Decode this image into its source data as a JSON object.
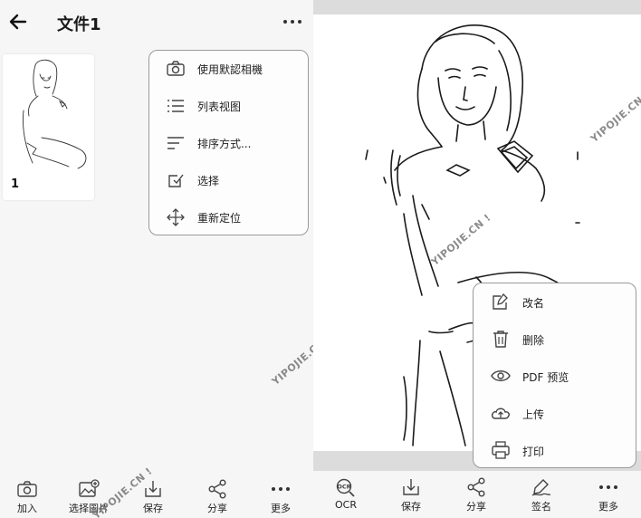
{
  "left_screen": {
    "title": "文件1",
    "page_number": "1",
    "menu": [
      {
        "label": "使用默認相機",
        "icon": "camera-icon"
      },
      {
        "label": "列表视图",
        "icon": "list-icon"
      },
      {
        "label": "排序方式...",
        "icon": "sort-icon"
      },
      {
        "label": "选择",
        "icon": "select-checkbox-icon"
      },
      {
        "label": "重新定位",
        "icon": "move-arrows-icon"
      }
    ],
    "bottom_bar": [
      {
        "label": "加入",
        "icon": "camera-icon"
      },
      {
        "label": "选择圖片",
        "icon": "add-image-icon"
      },
      {
        "label": "保存",
        "icon": "download-icon"
      },
      {
        "label": "分享",
        "icon": "share-icon"
      },
      {
        "label": "更多",
        "icon": "more-dots-icon"
      }
    ]
  },
  "right_screen": {
    "menu": [
      {
        "label": "改名",
        "icon": "rename-icon"
      },
      {
        "label": "删除",
        "icon": "trash-icon"
      },
      {
        "label": "PDF 预览",
        "icon": "eye-icon"
      },
      {
        "label": "上传",
        "icon": "cloud-upload-icon"
      },
      {
        "label": "打印",
        "icon": "printer-icon"
      }
    ],
    "bottom_bar": [
      {
        "label": "OCR",
        "icon": "ocr-icon"
      },
      {
        "label": "保存",
        "icon": "download-icon"
      },
      {
        "label": "分享",
        "icon": "share-icon"
      },
      {
        "label": "签名",
        "icon": "signature-icon"
      },
      {
        "label": "更多",
        "icon": "more-dots-icon"
      }
    ]
  },
  "watermarks": {
    "text": "YIPOJIE.CN !"
  },
  "colors": {
    "panel_bg": "#f6f6f6",
    "popup_border": "#9a9a9a",
    "icon": "#444444"
  }
}
